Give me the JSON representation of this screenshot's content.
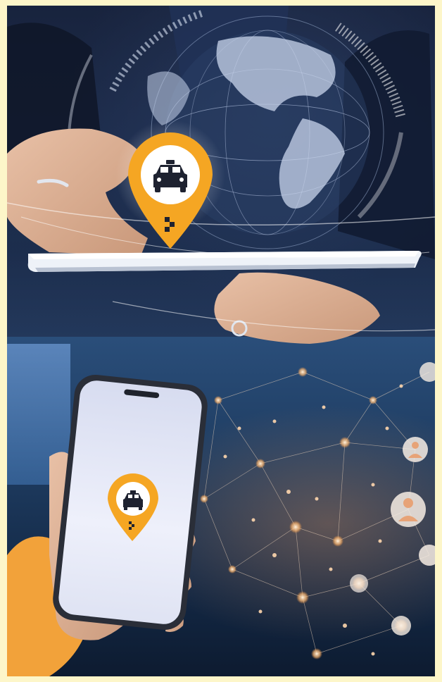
{
  "scene": {
    "type": "photo-collage",
    "top_subject": "taxi-location-pin-over-tablet",
    "bottom_subject": "smartphone-taxi-app-network",
    "colors": {
      "frame_border": "#fdf6c9",
      "pin_orange": "#f5a623",
      "pin_dark": "#e08a10",
      "globe_light": "#c9d6ec",
      "network_glow": "#ffcf9a",
      "suit_dark": "#1a2440"
    }
  },
  "icons": {
    "large_pin": "taxi-location-pin-icon",
    "small_pin": "taxi-location-pin-icon",
    "globe": "globe-icon",
    "network": "people-network-icon"
  }
}
